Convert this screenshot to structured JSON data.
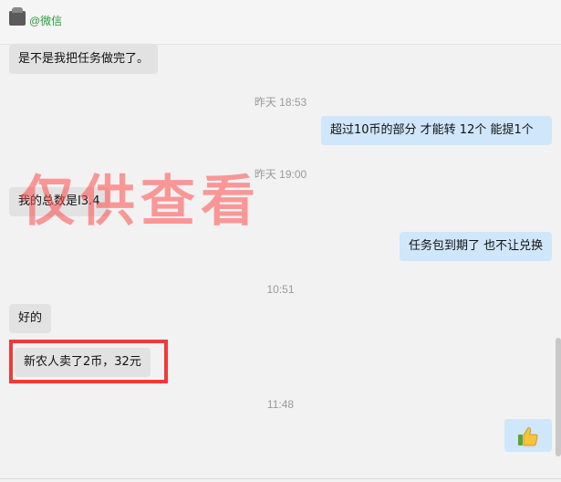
{
  "header": {
    "name": "@微信",
    "avatar_icon": "avatar-icon"
  },
  "messages": [
    {
      "text": "是不是我把任务做完了。"
    },
    {
      "text": "超过10币的部分  才能转    12个  能提1个"
    },
    {
      "text": "我的总数是I3.4"
    },
    {
      "text": "任务包到期了 也不让兑换"
    },
    {
      "text": "好的"
    },
    {
      "text": "新农人卖了2币，32元"
    }
  ],
  "timestamps": [
    "昨天 18:53",
    "昨天 19:00",
    "10:51",
    "11:48"
  ],
  "watermark": "仅供查看",
  "emoji": {
    "icon": "thumbs-up-icon"
  },
  "colors": {
    "incoming": "#e2e2e2",
    "outgoing": "#cfe6fb",
    "highlight": "#f03a3a",
    "watermark": "#ff4d4d"
  }
}
